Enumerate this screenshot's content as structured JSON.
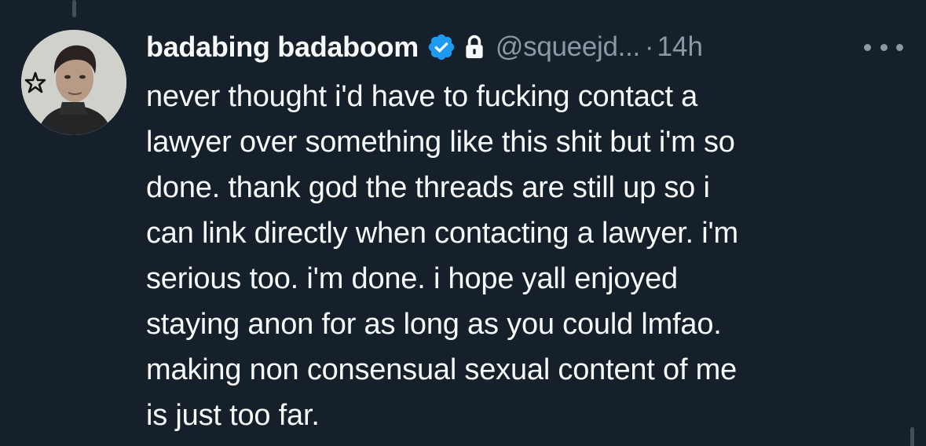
{
  "colors": {
    "background": "#15202b",
    "primary_text": "#f7f9f9",
    "secondary_text": "#8b98a5",
    "verified_badge": "#1d9bf0",
    "thread_line": "#42505d"
  },
  "tweet": {
    "author": {
      "display_name": "badabing badaboom",
      "handle": "@squeejd...",
      "verified_icon": "verified-badge-icon",
      "protected_icon": "lock-icon",
      "avatar_icon": "profile-photo"
    },
    "separator": "·",
    "timestamp": "14h",
    "more_icon": "more-horizontal-icon",
    "text_lines": [
      "never thought i'd have to fucking contact a",
      "lawyer over something like this shit but i'm so",
      "done. thank god the threads are still up so i",
      "can link directly when contacting a lawyer. i'm",
      "serious too. i'm done. i hope yall enjoyed",
      "staying anon for as long as you could lmfao.",
      "making non consensual sexual content of me",
      "is just too far."
    ]
  }
}
